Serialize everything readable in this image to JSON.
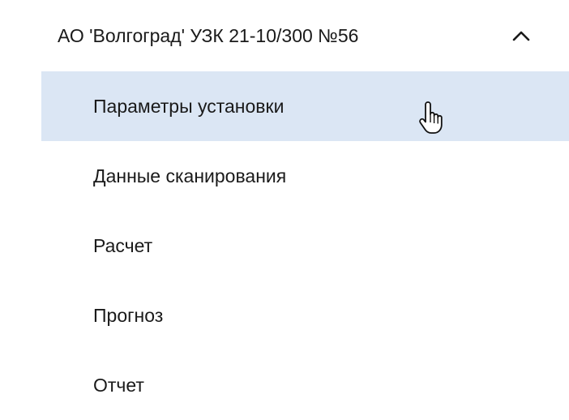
{
  "group": {
    "title": "АО 'Волгоград' УЗК 21-10/300 №56",
    "expanded": true,
    "toggle_icon": "chevron-up-icon",
    "items": [
      {
        "id": "params",
        "label": "Параметры установки",
        "active": true
      },
      {
        "id": "scan",
        "label": "Данные сканирования",
        "active": false
      },
      {
        "id": "calc",
        "label": "Расчет",
        "active": false
      },
      {
        "id": "forecast",
        "label": "Прогноз",
        "active": false
      },
      {
        "id": "report",
        "label": "Отчет",
        "active": false
      }
    ]
  },
  "cursor": {
    "icon": "hand-pointer-icon"
  },
  "colors": {
    "active_background": "#dbe6f4",
    "text": "#1a1a1a",
    "background": "#ffffff"
  }
}
